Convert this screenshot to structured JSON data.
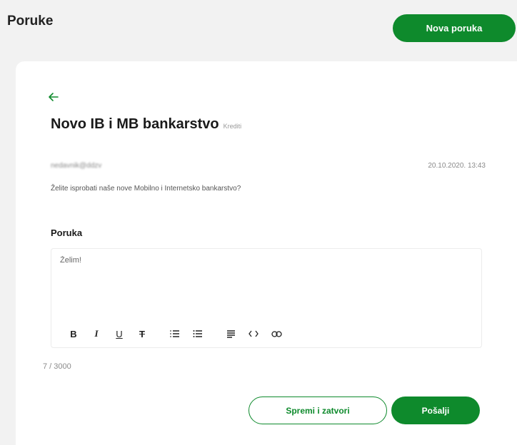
{
  "header": {
    "title": "Poruke",
    "new_message_label": "Nova poruka"
  },
  "message": {
    "subject": "Novo IB i MB bankarstvo",
    "category": "Krediti",
    "sender": "nedavnik@ddzv",
    "date": "20.10.2020. 13:43",
    "preview": "Želite isprobati naše nove Mobilno i Internetsko bankarstvo?"
  },
  "reply": {
    "label": "Poruka",
    "text": "Želim!",
    "counter": "7 / 3000",
    "toolbar": {
      "bold": "B",
      "italic": "I",
      "underline": "U",
      "strike": "T",
      "icons": [
        "bold-icon",
        "italic-icon",
        "underline-icon",
        "strikethrough-icon",
        "ordered-list-icon",
        "bullet-list-icon",
        "align-icon",
        "code-icon",
        "link-icon"
      ]
    }
  },
  "actions": {
    "save_close_label": "Spremi i zatvori",
    "send_label": "Pošalji"
  },
  "colors": {
    "accent": "#0e8a2c",
    "background": "#f2f2f2",
    "card": "#ffffff"
  }
}
